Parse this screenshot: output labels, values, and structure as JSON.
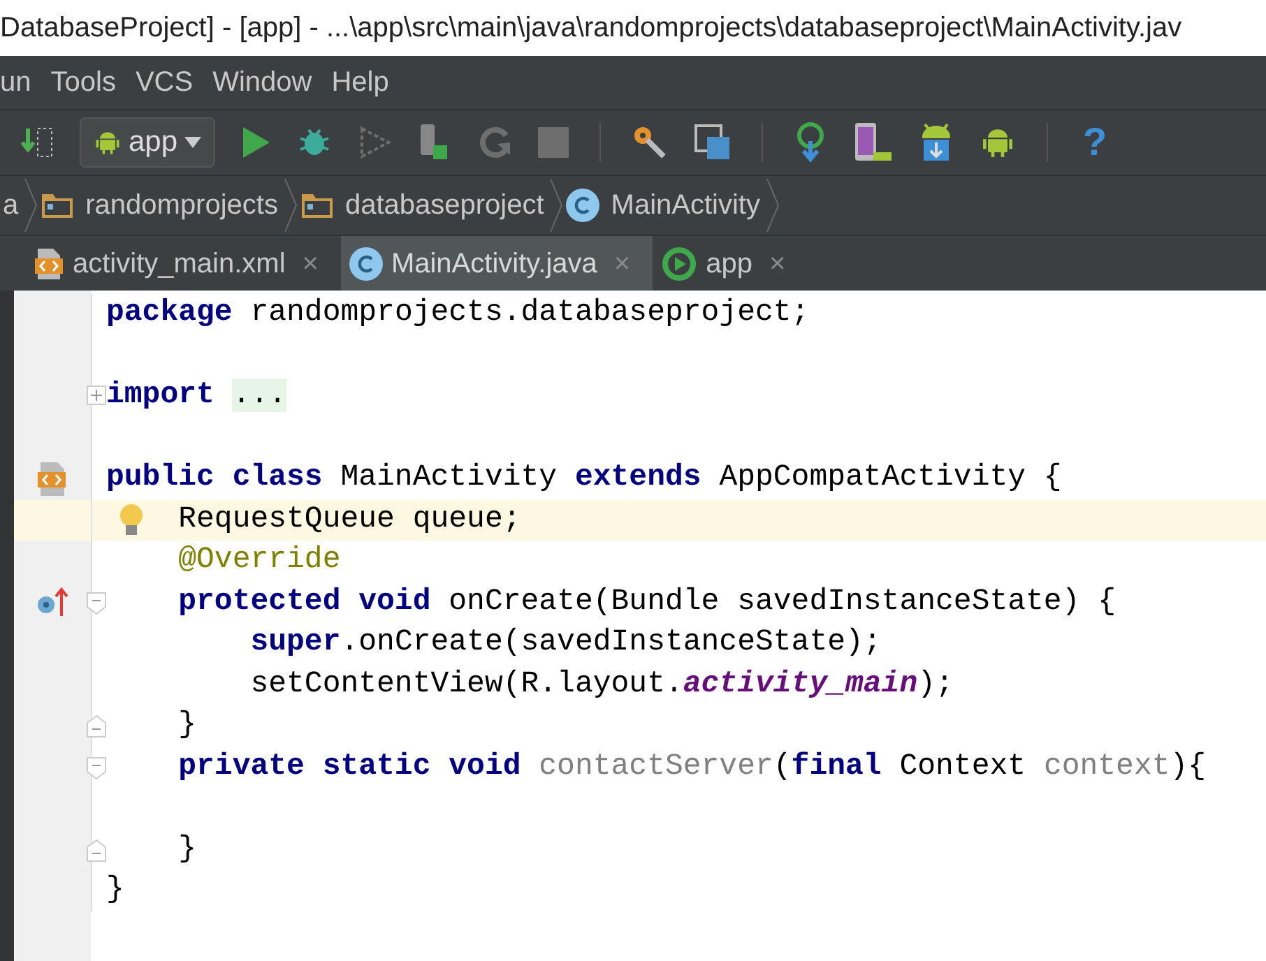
{
  "window": {
    "title": "DatabaseProject] - [app] - ...\\app\\src\\main\\java\\randomprojects\\databaseproject\\MainActivity.jav"
  },
  "menu": [
    "un",
    "Tools",
    "VCS",
    "Window",
    "Help"
  ],
  "toolbar": [
    {
      "kind": "make",
      "disabled": false
    },
    {
      "kind": "config",
      "label": "app",
      "disabled": false
    },
    {
      "kind": "run",
      "disabled": false
    },
    {
      "kind": "debug",
      "disabled": false
    },
    {
      "kind": "coverage",
      "disabled": true
    },
    {
      "kind": "attach",
      "disabled": false
    },
    {
      "kind": "rerun",
      "disabled": true
    },
    {
      "kind": "stop",
      "disabled": true
    },
    {
      "kind": "separator"
    },
    {
      "kind": "settings",
      "disabled": false
    },
    {
      "kind": "structure",
      "disabled": false
    },
    {
      "kind": "separator"
    },
    {
      "kind": "sync",
      "disabled": false
    },
    {
      "kind": "avd",
      "disabled": false
    },
    {
      "kind": "sdk",
      "disabled": false
    },
    {
      "kind": "monitor",
      "disabled": false
    },
    {
      "kind": "separator"
    },
    {
      "kind": "help",
      "label": "?",
      "disabled": false
    }
  ],
  "breadcrumbs": [
    {
      "kind": "text",
      "label": "a"
    },
    {
      "kind": "folder",
      "label": "randomprojects"
    },
    {
      "kind": "folder",
      "label": "databaseproject"
    },
    {
      "kind": "class",
      "label": "MainActivity"
    }
  ],
  "tabs": [
    {
      "kind": "xml",
      "label": "activity_main.xml",
      "close": "×",
      "selected": false
    },
    {
      "kind": "class",
      "label": "MainActivity.java",
      "close": "×",
      "selected": true
    },
    {
      "kind": "run",
      "label": "app",
      "close": "×",
      "selected": false
    }
  ],
  "editor": {
    "lines": [
      {
        "kind": "code",
        "current": false,
        "tokens": [
          {
            "kind": "keyword",
            "text": "package"
          },
          {
            "kind": "plain",
            "text": " randomprojects.databaseproject;"
          }
        ]
      },
      {
        "kind": "blank",
        "current": false
      },
      {
        "kind": "code",
        "current": false,
        "fold": {
          "kind": "collapsed"
        },
        "tokens": [
          {
            "kind": "keyword",
            "text": "import"
          },
          {
            "kind": "folded",
            "text": " ..."
          }
        ]
      },
      {
        "kind": "blank",
        "current": false
      },
      {
        "kind": "code",
        "current": false,
        "marker": {
          "kind": "layout"
        },
        "tokens": [
          {
            "kind": "keyword",
            "text": "public class"
          },
          {
            "kind": "plain",
            "text": " MainActivity "
          },
          {
            "kind": "keyword",
            "text": "extends"
          },
          {
            "kind": "plain",
            "text": " AppCompatActivity {"
          }
        ]
      },
      {
        "kind": "code",
        "current": true,
        "intention": {
          "kind": "bulb"
        },
        "tokens": [
          {
            "kind": "plain",
            "text": "    RequestQueue queue;"
          }
        ]
      },
      {
        "kind": "code",
        "current": false,
        "tokens": [
          {
            "kind": "annotation",
            "text": "    @Override"
          }
        ]
      },
      {
        "kind": "code",
        "current": false,
        "marker": {
          "kind": "override"
        },
        "fold": {
          "kind": "start"
        },
        "tokens": [
          {
            "kind": "keyword",
            "text": "    protected void"
          },
          {
            "kind": "plain",
            "text": " onCreate(Bundle savedInstanceState) {"
          }
        ]
      },
      {
        "kind": "code",
        "current": false,
        "tokens": [
          {
            "kind": "keyword",
            "text": "        super"
          },
          {
            "kind": "plain",
            "text": ".onCreate(savedInstanceState);"
          }
        ]
      },
      {
        "kind": "code",
        "current": false,
        "tokens": [
          {
            "kind": "plain",
            "text": "        setContentView(R.layout."
          },
          {
            "kind": "field",
            "text": "activity_main"
          },
          {
            "kind": "plain",
            "text": ");"
          }
        ]
      },
      {
        "kind": "code",
        "current": false,
        "fold": {
          "kind": "end"
        },
        "tokens": [
          {
            "kind": "plain",
            "text": "    }"
          }
        ]
      },
      {
        "kind": "code",
        "current": false,
        "fold": {
          "kind": "start"
        },
        "tokens": [
          {
            "kind": "keyword",
            "text": "    private static void"
          },
          {
            "kind": "unused",
            "text": " contactServer"
          },
          {
            "kind": "plain",
            "text": "("
          },
          {
            "kind": "keyword",
            "text": "final"
          },
          {
            "kind": "plain",
            "text": " Context "
          },
          {
            "kind": "unused",
            "text": "context"
          },
          {
            "kind": "plain",
            "text": "){"
          }
        ]
      },
      {
        "kind": "blank",
        "current": false
      },
      {
        "kind": "code",
        "current": false,
        "fold": {
          "kind": "end"
        },
        "tokens": [
          {
            "kind": "plain",
            "text": "    }"
          }
        ]
      },
      {
        "kind": "code",
        "current": false,
        "tokens": [
          {
            "kind": "plain",
            "text": "}"
          }
        ]
      }
    ]
  }
}
